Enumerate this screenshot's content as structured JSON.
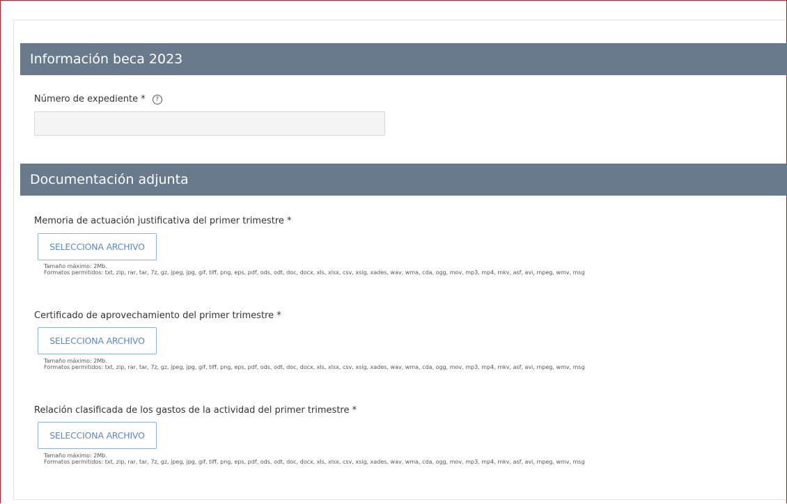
{
  "sections": {
    "info": {
      "title": "Información beca 2023"
    },
    "docs": {
      "title": "Documentación adjunta"
    }
  },
  "expediente": {
    "label": "Número de expediente *",
    "help_icon": "question-circle-icon",
    "value": ""
  },
  "documents": [
    {
      "label": "Memoria de actuación justificativa del primer trimestre *",
      "button": "SELECCIONA ARCHIVO",
      "max_size": "Tamaño máximo: 2Mb.",
      "formats": "Formatos permitidos: txt, zip, rar, tar, 7z, gz, jpeg, jpg, gif, tiff, png, eps, pdf, ods, odt, doc, docx, xls, xlsx, csv, xsig, xades, wav, wma, cda, ogg, mov, mp3, mp4, mkv, asf, avi, mpeg, wmv, msg"
    },
    {
      "label": "Certificado de aprovechamiento del primer trimestre *",
      "button": "SELECCIONA ARCHIVO",
      "max_size": "Tamaño máximo: 2Mb.",
      "formats": "Formatos permitidos: txt, zip, rar, tar, 7z, gz, jpeg, jpg, gif, tiff, png, eps, pdf, ods, odt, doc, docx, xls, xlsx, csv, xsig, xades, wav, wma, cda, ogg, mov, mp3, mp4, mkv, asf, avi, mpeg, wmv, msg"
    },
    {
      "label": "Relación clasificada de los gastos de la actividad del primer trimestre *",
      "button": "SELECCIONA ARCHIVO",
      "max_size": "Tamaño máximo: 2Mb.",
      "formats": "Formatos permitidos: txt, zip, rar, tar, 7z, gz, jpeg, jpg, gif, tiff, png, eps, pdf, ods, odt, doc, docx, xls, xlsx, csv, xsig, xades, wav, wma, cda, ogg, mov, mp3, mp4, mkv, asf, avi, mpeg, wmv, msg"
    }
  ],
  "colors": {
    "section_header_bg": "#687a8c",
    "frame_border": "#a31f2a",
    "button_text": "#5a88c4",
    "button_border": "#8fb0d8"
  }
}
